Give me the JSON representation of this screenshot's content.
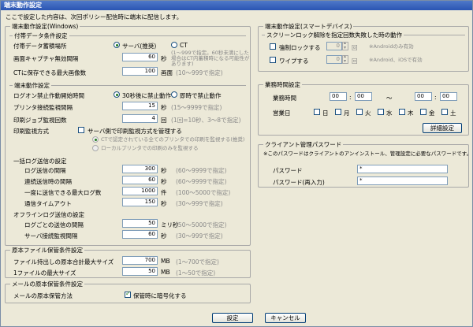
{
  "window": {
    "title": "端末動作設定"
  },
  "intro": "ここで設定した内容は、次回ポリシー配信時に端末に配信します。",
  "left_group": {
    "title": "端末動作設定(Windows)",
    "attach": {
      "title": "付帯データ条件設定",
      "location_label": "付帯データ蓄積場所",
      "location_options": [
        "サーバ(推奨)",
        "CT"
      ],
      "location_note": "(1〜999で指定。60秒未満にした場合はCT内蓄積時になる可能性があります)",
      "capture_label": "画面キャプチャ無効間隔",
      "capture_value": "60",
      "capture_unit": "秒",
      "ct_save_label": "CTに保存できる最大画像数",
      "ct_save_value": "100",
      "ct_save_unit": "画面",
      "ct_save_range": "(10〜999で指定)"
    },
    "device": {
      "title": "端末動作設定",
      "logon_label": "ログオン禁止作動開始時間",
      "logon_options": [
        "30秒後に禁止動作",
        "即時で禁止動作"
      ],
      "printer_label": "プリンタ接続監視間隔",
      "printer_value": "15",
      "printer_unit": "秒",
      "printer_range": "(15〜9999で指定)",
      "printjob_label": "印刷ジョブ監視回数",
      "printjob_value": "4",
      "printjob_unit": "回",
      "printjob_range": "(1回=10秒、3〜8で指定)",
      "print_method_label": "印刷監視方式",
      "print_method_check": "サーバ側で印刷監視方式を管理する",
      "print_method_opt1": "CTで認定されている全てのプリンタでの印刷を監視する(推奨)",
      "print_method_opt2": "ローカルプリンタでの印刷のみを監視する"
    },
    "log": {
      "title": "一括ログ送信の設定",
      "rows": [
        {
          "label": "ログ送信の間隔",
          "value": "300",
          "unit": "秒",
          "range": "(60〜9999で指定)"
        },
        {
          "label": "連続送信時の間隔",
          "value": "60",
          "unit": "秒",
          "range": "(60〜9999で指定)"
        },
        {
          "label": "一度に送信できる最大ログ数",
          "value": "1000",
          "unit": "件",
          "range": "(100〜5000で指定)"
        },
        {
          "label": "通信タイムアウト",
          "value": "150",
          "unit": "秒",
          "range": "(30〜999で指定)"
        }
      ]
    },
    "offline": {
      "title": "オフラインログ送信の設定",
      "rows": [
        {
          "label": "ログごとの送信の間隔",
          "value": "50",
          "unit": "ミリ秒",
          "range": "(50〜5000で指定)"
        },
        {
          "label": "サーバ接続監視間隔",
          "value": "60",
          "unit": "秒",
          "range": "(30〜999で指定)"
        }
      ]
    }
  },
  "file_group": {
    "title": "原本ファイル保管条件設定",
    "rows": [
      {
        "label": "ファイル持出しの原本合計最大サイズ",
        "value": "700",
        "unit": "MB",
        "range": "(1〜700で指定)"
      },
      {
        "label": "1ファイルの最大サイズ",
        "value": "50",
        "unit": "MB",
        "range": "(1〜50で指定)"
      }
    ]
  },
  "mail_group": {
    "title": "メールの原本保管条件設定",
    "method_label": "メールの原本保管方法",
    "encrypt_label": "保管時に暗号化する"
  },
  "smart_group": {
    "title": "端末動作設定(スマートデバイス)",
    "sub_title": "スクリーンロック解除を指定回数失敗した時の動作",
    "rows": [
      {
        "label": "強制ロックする",
        "value": "0",
        "unit": "回",
        "note": "※Androidのみ有効"
      },
      {
        "label": "ワイプする",
        "value": "0",
        "unit": "回",
        "note": "※Android、iOSで有効"
      }
    ]
  },
  "business_group": {
    "title": "業務時間設定",
    "time_label": "業務時間",
    "time_from_h": "00",
    "time_from_m": "00",
    "tilde": "〜",
    "time_to_h": "00",
    "time_to_m": "00",
    "colon": ":",
    "days_label": "営業日",
    "days": [
      "日",
      "月",
      "火",
      "水",
      "木",
      "金",
      "土"
    ],
    "detail_button": "詳細設定"
  },
  "client_group": {
    "title": "クライアント管理パスワード",
    "note": "※このパスワードはクライアントのアンインストール、管理設定に必要なパスワードです。",
    "password_label": "パスワード",
    "password_value": "*",
    "password2_label": "パスワード(再入力)",
    "password2_value": "*"
  },
  "footer": {
    "ok": "設定",
    "cancel": "キャンセル"
  }
}
